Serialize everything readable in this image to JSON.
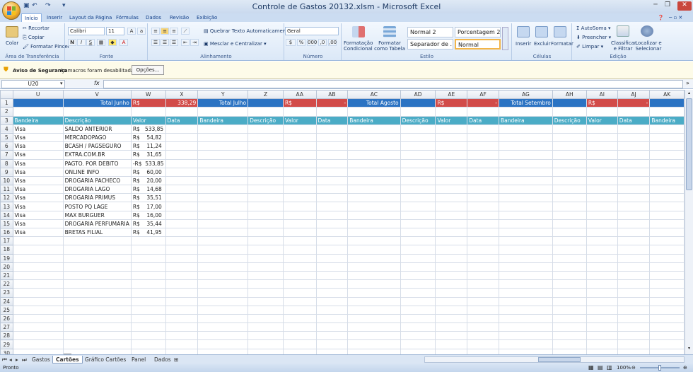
{
  "window": {
    "title": "Controle de Gastos 20132.xlsm - Microsoft Excel"
  },
  "qat": {
    "undo": "↶",
    "redo": "↷",
    "customize": "▾"
  },
  "ribbon_tabs": [
    "Início",
    "Inserir",
    "Layout da Página",
    "Fórmulas",
    "Dados",
    "Revisão",
    "Exibição"
  ],
  "ribbon": {
    "clipboard": {
      "label": "Área de Transferência",
      "paste": "Colar",
      "cut": "Recortar",
      "copy": "Copiar",
      "format_painter": "Formatar Pincel"
    },
    "font": {
      "label": "Fonte",
      "name": "Calibri",
      "size": "11"
    },
    "alignment": {
      "label": "Alinhamento",
      "wrap": "Quebrar Texto Automaticamente",
      "merge": "Mesclar e Centralizar"
    },
    "number": {
      "label": "Número",
      "format": "Geral"
    },
    "styles": {
      "label": "Estilo",
      "conditional": "Formatação Condicional",
      "as_table": "Formatar como Tabela",
      "cells": [
        "Normal 2",
        "Porcentagem 2",
        "Separador de ...",
        "Normal"
      ]
    },
    "cells": {
      "label": "Células",
      "insert": "Inserir",
      "delete": "Excluir",
      "format": "Formatar"
    },
    "editing": {
      "label": "Edição",
      "autosum": "AutoSoma",
      "fill": "Preencher",
      "clear": "Limpar",
      "sort": "Classificar e Filtrar",
      "find": "Localizar e Selecionar"
    }
  },
  "security": {
    "title": "Aviso de Segurança",
    "message": "As macros foram desabilitadas.",
    "options": "Opções..."
  },
  "formula_bar": {
    "name_box": "U20",
    "fx": "fx",
    "formula": ""
  },
  "columns": [
    "U",
    "V",
    "W",
    "X",
    "Y",
    "Z",
    "AA",
    "AB",
    "AC",
    "AD",
    "AE",
    "AF",
    "AG",
    "AH",
    "AI",
    "AJ",
    "AK"
  ],
  "row_numbers": [
    "1",
    "2",
    "3",
    "4",
    "5",
    "6",
    "7",
    "8",
    "9",
    "10",
    "11",
    "12",
    "13",
    "14",
    "15",
    "16",
    "17",
    "18",
    "19",
    "20",
    "21",
    "22",
    "23",
    "24",
    "25",
    "26",
    "27",
    "28",
    "29",
    "30"
  ],
  "row1": [
    "",
    "Total  Junho",
    "R$",
    "338,29",
    "Total  Julho",
    "",
    "R$",
    "-",
    "Total  Agosto",
    "",
    "R$",
    "-",
    "Total  Setembro",
    "",
    "R$",
    "-",
    ""
  ],
  "row3": [
    "Bandeira",
    "Descrição",
    "Valor",
    "Data",
    "Bandeira",
    "Descrição",
    "Valor",
    "Data",
    "Bandeira",
    "Descrição",
    "Valor",
    "Data",
    "Bandeira",
    "Descrição",
    "Valor",
    "Data",
    "Bandeira"
  ],
  "entries": [
    {
      "bandeira": "Visa",
      "descricao": "SALDO ANTERIOR",
      "valor": "R$   533,85"
    },
    {
      "bandeira": "Visa",
      "descricao": "MERCADOPAGO",
      "valor": "R$    54,82"
    },
    {
      "bandeira": "Visa",
      "descricao": "BCASH / PAGSEGURO",
      "valor": "R$    11,24"
    },
    {
      "bandeira": "Visa",
      "descricao": "EXTRA.COM.BR",
      "valor": "R$    31,65"
    },
    {
      "bandeira": "Visa",
      "descricao": "PAGTO. POR DEBITO",
      "valor": "-R$  533,85"
    },
    {
      "bandeira": "Visa",
      "descricao": "ONLINE INFO",
      "valor": "R$    60,00"
    },
    {
      "bandeira": "Visa",
      "descricao": "DROGARIA PACHECO",
      "valor": "R$    20,00"
    },
    {
      "bandeira": "Visa",
      "descricao": "DROGARIA LAGO",
      "valor": "R$    14,68"
    },
    {
      "bandeira": "Visa",
      "descricao": "DROGARIA PRIMUS",
      "valor": "R$    35,51"
    },
    {
      "bandeira": "Visa",
      "descricao": "POSTO PQ LAGE",
      "valor": "R$    17,00"
    },
    {
      "bandeira": "Visa",
      "descricao": "MAX BURGUER",
      "valor": "R$    16,00"
    },
    {
      "bandeira": "Visa",
      "descricao": "DROGARIA PERFUMARIA",
      "valor": "R$    35,44"
    },
    {
      "bandeira": "Visa",
      "descricao": "BRETAS FILIAL",
      "valor": "R$    41,95"
    }
  ],
  "sheet_tabs": [
    "Gastos",
    "Cartões",
    "Gráfico Cartões",
    "Panel",
    "Dados"
  ],
  "status": {
    "ready": "Pronto",
    "zoom": "100%"
  },
  "colors": {
    "header_blue": "#2b73c3",
    "total_red": "#d24b49",
    "header_teal": "#4bacc6"
  }
}
